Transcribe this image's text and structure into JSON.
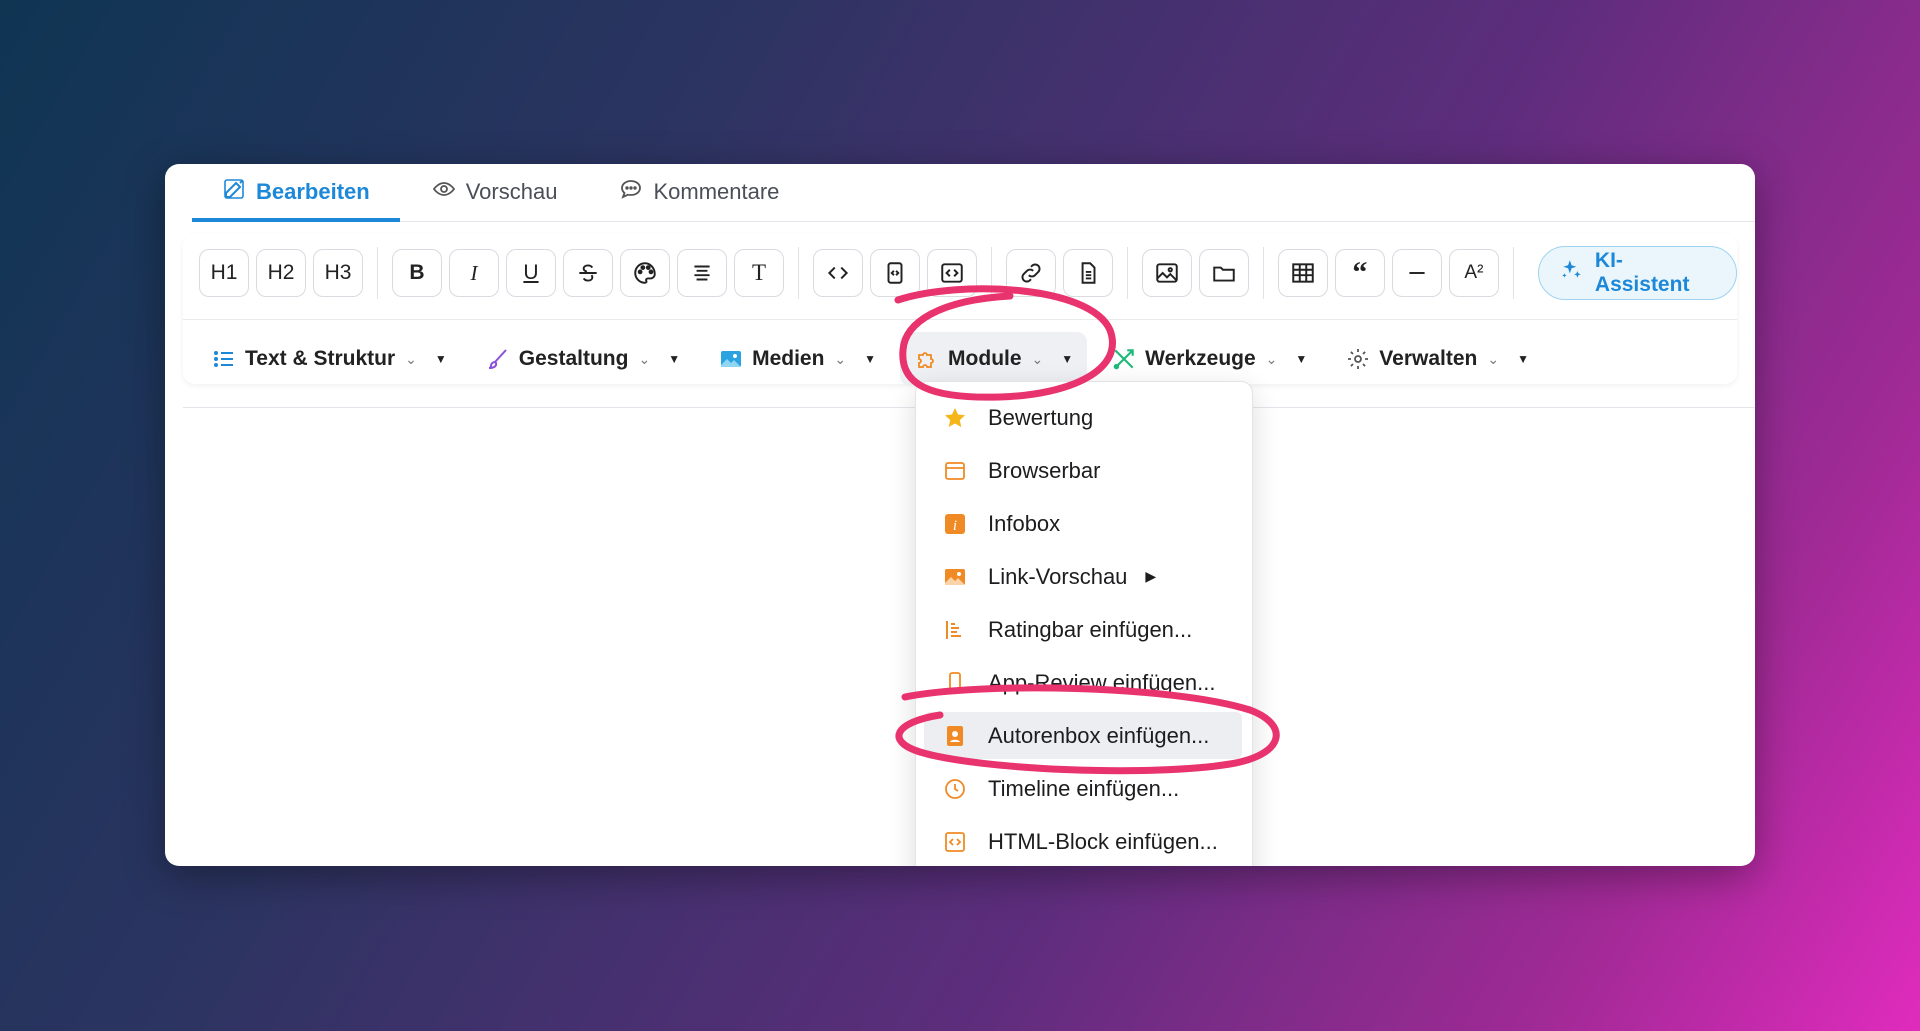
{
  "tabs": [
    {
      "label": "Bearbeiten",
      "icon": "edit-icon",
      "active": true
    },
    {
      "label": "Vorschau",
      "icon": "eye-icon",
      "active": false
    },
    {
      "label": "Kommentare",
      "icon": "comment-icon",
      "active": false
    }
  ],
  "toolbar": {
    "h1": "H1",
    "h2": "H2",
    "h3": "H3",
    "bold": "B",
    "italic": "I",
    "underline": "U",
    "text": "T",
    "superscript": "A²",
    "ki_assistant": "KI-Assistent"
  },
  "menus": [
    {
      "label": "Text & Struktur",
      "icon": "list-icon"
    },
    {
      "label": "Gestaltung",
      "icon": "brush-icon"
    },
    {
      "label": "Medien",
      "icon": "image-icon"
    },
    {
      "label": "Module",
      "icon": "puzzle-icon",
      "active": true
    },
    {
      "label": "Werkzeuge",
      "icon": "tools-icon"
    },
    {
      "label": "Verwalten",
      "icon": "gear-icon"
    }
  ],
  "dropdown": {
    "items": [
      {
        "label": "Bewertung",
        "icon": "star-icon"
      },
      {
        "label": "Browserbar",
        "icon": "browser-icon"
      },
      {
        "label": "Infobox",
        "icon": "info-icon"
      },
      {
        "label": "Link-Vorschau",
        "icon": "picture-icon",
        "has_submenu": true
      },
      {
        "label": "Ratingbar einfügen...",
        "icon": "bars-icon"
      },
      {
        "label": "App-Review einfügen...",
        "icon": "phone-icon"
      },
      {
        "label": "Autorenbox einfügen...",
        "icon": "author-icon",
        "highlighted": true
      },
      {
        "label": "Timeline einfügen...",
        "icon": "clock-icon"
      },
      {
        "label": "HTML-Block einfügen...",
        "icon": "code-icon"
      }
    ]
  },
  "colors": {
    "accent": "#1e88d8",
    "module_orange": "#f08a24",
    "annotation_pink": "#e8336e"
  }
}
